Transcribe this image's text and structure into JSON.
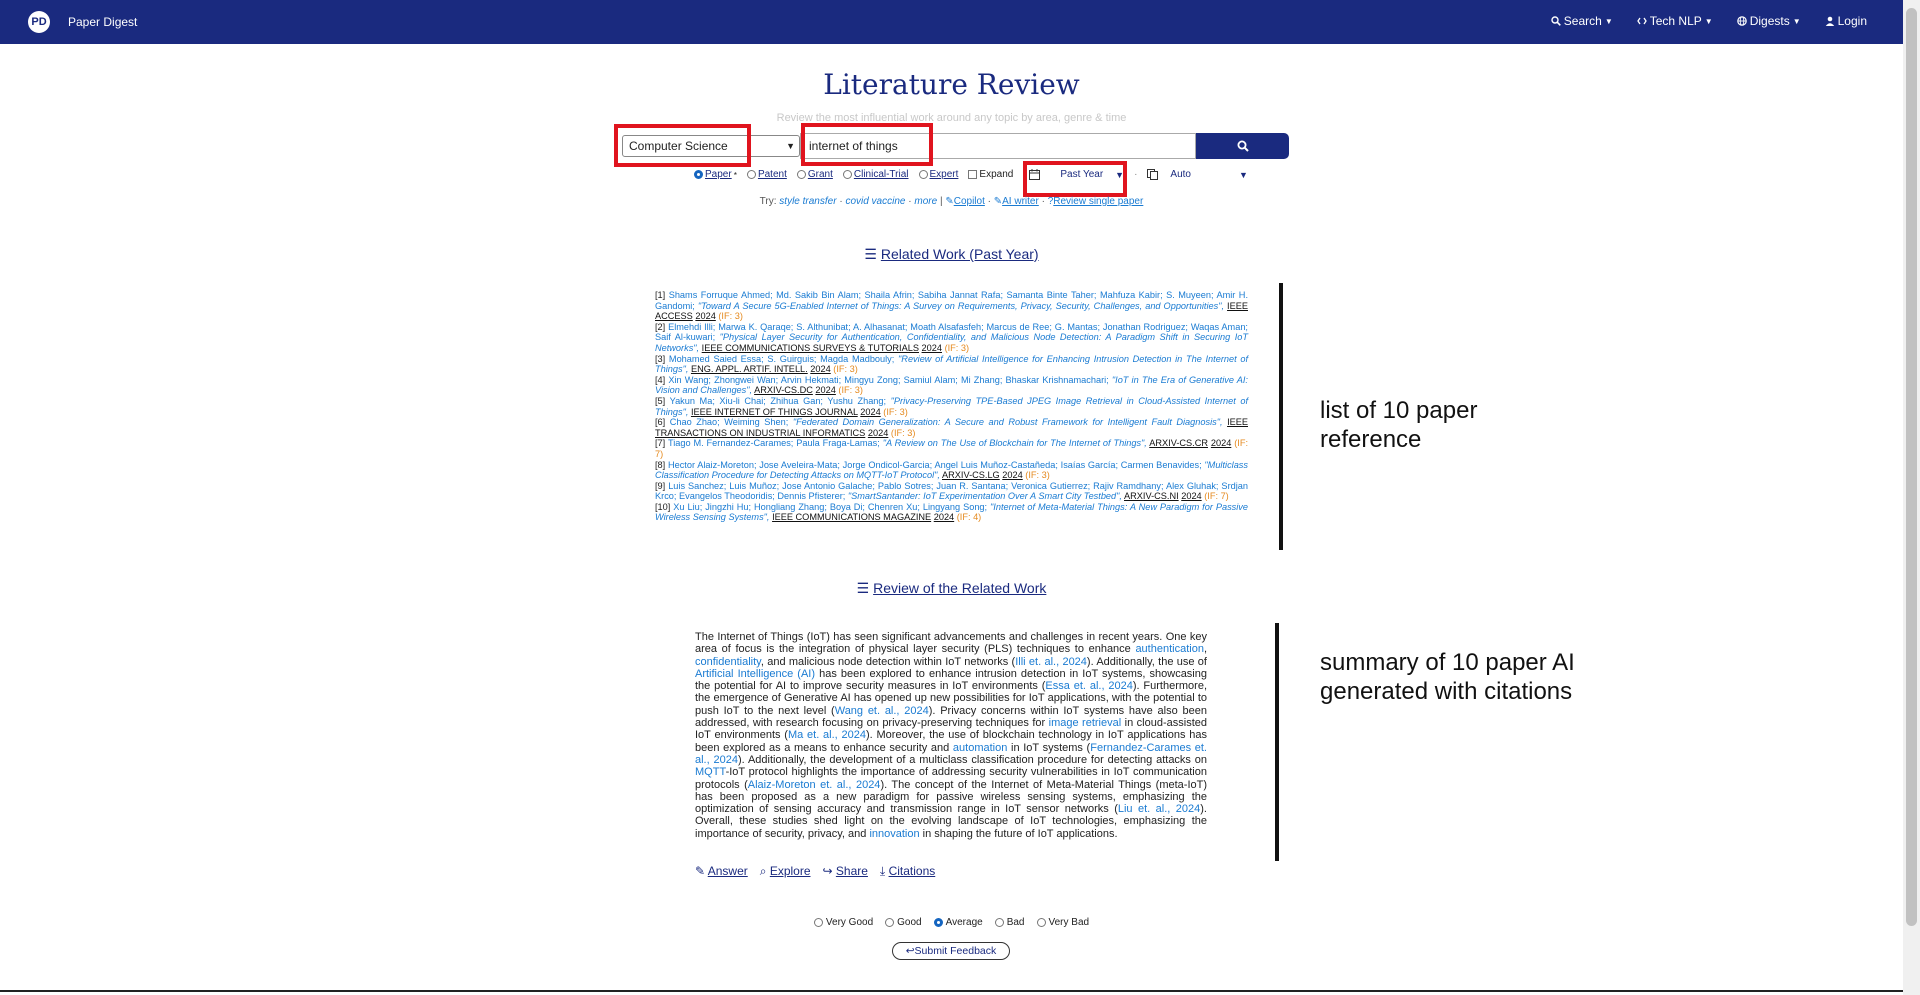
{
  "nav": {
    "brand_logo": "PD",
    "brand": "Paper Digest",
    "items": [
      {
        "icon": "search-icon",
        "label": "Search"
      },
      {
        "icon": "code-icon",
        "label": "Tech NLP"
      },
      {
        "icon": "globe-icon",
        "label": "Digests"
      },
      {
        "icon": "user-icon",
        "label": "Login"
      }
    ]
  },
  "header": {
    "title": "Literature Review",
    "subtitle": "Review the most influential work around any topic by area, genre & time"
  },
  "search": {
    "field_select": "Computer Science",
    "query": "internet of things"
  },
  "options": {
    "types": [
      {
        "label": "Paper",
        "checked": true
      },
      {
        "label": "Patent",
        "checked": false
      },
      {
        "label": "Grant",
        "checked": false
      },
      {
        "label": "Clinical-Trial",
        "checked": false
      },
      {
        "label": "Expert",
        "checked": false
      }
    ],
    "expand_label": "Expand",
    "time_select": "Past Year",
    "mode_select": "Auto"
  },
  "try": {
    "prefix": "Try:",
    "examples": [
      "style transfer",
      "covid vaccine",
      "more"
    ],
    "links": [
      "Copilot",
      "AI writer",
      "Review single paper"
    ]
  },
  "related_heading": "Related Work (Past Year)",
  "references": [
    {
      "n": "[1]",
      "authors": "Shams Forruque Ahmed; Md. Sakib Bin Alam; Shaila Afrin; Sabiha Jannat Rafa; Samanta Binte Taher; Mahfuza Kabir; S. Muyeen; Amir H. Gandomi;",
      "title": "\"Toward A Secure 5G-Enabled Internet of Things: A Survey on Requirements, Privacy, Security, Challenges, and Opportunities\",",
      "venue": "IEEE ACCESS",
      "year": "2024",
      "if": "(IF: 3)"
    },
    {
      "n": "[2]",
      "authors": "Elmehdi Illi; Marwa K. Qaraqe; S. Althunibat; A. Alhasanat; Moath Alsafasfeh; Marcus de Ree; G. Mantas; Jonathan Rodriguez; Waqas Aman; Saif Al-kuwari;",
      "title": "\"Physical Layer Security for Authentication, Confidentiality, and Malicious Node Detection: A Paradigm Shift in Securing IoT Networks\",",
      "venue": "IEEE COMMUNICATIONS SURVEYS & TUTORIALS",
      "year": "2024",
      "if": "(IF: 3)"
    },
    {
      "n": "[3]",
      "authors": "Mohamed Saied Essa; S. Guirguis; Magda Madbouly;",
      "title": "\"Review of Artificial Intelligence for Enhancing Intrusion Detection in The Internet of Things\",",
      "venue": "ENG. APPL. ARTIF. INTELL.",
      "year": "2024",
      "if": "(IF: 3)"
    },
    {
      "n": "[4]",
      "authors": "Xin Wang; Zhongwei Wan; Arvin Hekmati; Mingyu Zong; Samiul Alam; Mi Zhang; Bhaskar Krishnamachari;",
      "title": "\"IoT in The Era of Generative AI: Vision and Challenges\",",
      "venue": "ARXIV-CS.DC",
      "year": "2024",
      "if": "(IF: 3)"
    },
    {
      "n": "[5]",
      "authors": "Yakun Ma; Xiu-li Chai; Zhihua Gan; Yushu Zhang;",
      "title": "\"Privacy-Preserving TPE-Based JPEG Image Retrieval in Cloud-Assisted Internet of Things\",",
      "venue": "IEEE INTERNET OF THINGS JOURNAL",
      "year": "2024",
      "if": "(IF: 3)"
    },
    {
      "n": "[6]",
      "authors": "Chao Zhao; Weiming Shen;",
      "title": "\"Federated Domain Generalization: A Secure and Robust Framework for Intelligent Fault Diagnosis\",",
      "venue": "IEEE TRANSACTIONS ON INDUSTRIAL INFORMATICS",
      "year": "2024",
      "if": "(IF: 3)"
    },
    {
      "n": "[7]",
      "authors": "Tiago M. Fernandez-Carames; Paula Fraga-Lamas;",
      "title": "\"A Review on The Use of Blockchain for The Internet of Things\",",
      "venue": "ARXIV-CS.CR",
      "year": "2024",
      "if": "(IF: 7)"
    },
    {
      "n": "[8]",
      "authors": "Hector Alaiz-Moreton; Jose Aveleira-Mata; Jorge Ondicol-Garcia; Angel Luis Muñoz-Castañeda; Isaías García; Carmen Benavides;",
      "title": "\"Multiclass Classification Procedure for Detecting Attacks on MQTT-IoT Protocol\",",
      "venue": "ARXIV-CS.LG",
      "year": "2024",
      "if": "(IF: 3)"
    },
    {
      "n": "[9]",
      "authors": "Luis Sanchez; Luis Muñoz; Jose Antonio Galache; Pablo Sotres; Juan R. Santana; Veronica Gutierrez; Rajiv Ramdhany; Alex Gluhak; Srdjan Krco; Evangelos Theodoridis; Dennis Pfisterer;",
      "title": "\"SmartSantander: IoT Experimentation Over A Smart City Testbed\",",
      "venue": "ARXIV-CS.NI",
      "year": "2024",
      "if": "(IF: 7)"
    },
    {
      "n": "[10]",
      "authors": "Xu Liu; Jingzhi Hu; Hongliang Zhang; Boya Di; Chenren Xu; Lingyang Song;",
      "title": "\"Internet of Meta-Material Things: A New Paradigm for Passive Wireless Sensing Systems\",",
      "venue": "IEEE COMMUNICATIONS MAGAZINE",
      "year": "2024",
      "if": "(IF: 4)"
    }
  ],
  "annotations": {
    "refs_note": "list of 10 paper reference",
    "summary_note": "summary of 10 paper AI generated with citations"
  },
  "review_heading": "Review of the Related Work",
  "summary": {
    "segments": [
      {
        "t": "The Internet of Things (IoT) has seen significant advancements and challenges in recent years. One key area of focus is the integration of physical layer security (PLS) techniques to enhance ",
        "c": false
      },
      {
        "t": "authentication",
        "c": true
      },
      {
        "t": ", ",
        "c": false
      },
      {
        "t": "confidentiality",
        "c": true
      },
      {
        "t": ", and malicious node detection within IoT networks (",
        "c": false
      },
      {
        "t": "Illi et. al., 2024",
        "c": true
      },
      {
        "t": "). Additionally, the use of ",
        "c": false
      },
      {
        "t": "Artificial Intelligence (AI)",
        "c": true
      },
      {
        "t": " has been explored to enhance intrusion detection in IoT systems, showcasing the potential for AI to improve security measures in IoT environments (",
        "c": false
      },
      {
        "t": "Essa et. al., 2024",
        "c": true
      },
      {
        "t": "). Furthermore, the emergence of Generative AI has opened up new possibilities for IoT applications, with the potential to push IoT to the next level (",
        "c": false
      },
      {
        "t": "Wang et. al., 2024",
        "c": true
      },
      {
        "t": "). Privacy concerns within IoT systems have also been addressed, with research focusing on privacy-preserving techniques for ",
        "c": false
      },
      {
        "t": "image retrieval",
        "c": true
      },
      {
        "t": " in cloud-assisted IoT environments (",
        "c": false
      },
      {
        "t": "Ma et. al., 2024",
        "c": true
      },
      {
        "t": "). Moreover, the use of blockchain technology in IoT applications has been explored as a means to enhance security and ",
        "c": false
      },
      {
        "t": "automation",
        "c": true
      },
      {
        "t": " in IoT systems (",
        "c": false
      },
      {
        "t": "Fernandez-Carames et. al., 2024",
        "c": true
      },
      {
        "t": "). Additionally, the development of a multiclass classification procedure for detecting attacks on ",
        "c": false
      },
      {
        "t": "MQTT",
        "c": true
      },
      {
        "t": "-IoT protocol highlights the importance of addressing security vulnerabilities in IoT communication protocols (",
        "c": false
      },
      {
        "t": "Alaiz-Moreton et. al., 2024",
        "c": true
      },
      {
        "t": "). The concept of the Internet of Meta-Material Things (meta-IoT) has been proposed as a new paradigm for passive wireless sensing systems, emphasizing the optimization of sensing accuracy and transmission range in IoT sensor networks (",
        "c": false
      },
      {
        "t": "Liu et. al., 2024",
        "c": true
      },
      {
        "t": "). Overall, these studies shed light on the evolving landscape of IoT technologies, emphasizing the importance of security, privacy, and ",
        "c": false
      },
      {
        "t": "innovation",
        "c": true
      },
      {
        "t": " in shaping the future of IoT applications.",
        "c": false
      }
    ]
  },
  "actions": [
    "Answer",
    "Explore",
    "Share",
    "Citations"
  ],
  "rating": {
    "options": [
      "Very Good",
      "Good",
      "Average",
      "Bad",
      "Very Bad"
    ],
    "selected": "Average"
  },
  "feedback_label": "Submit Feedback",
  "colors": {
    "nav_bg": "#1a2a7f",
    "highlight": "#e0141e",
    "link": "#1a7bd2",
    "impact": "#e58a1f"
  }
}
